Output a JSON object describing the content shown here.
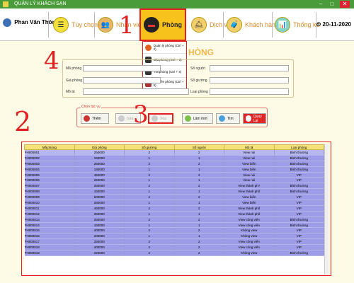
{
  "window": {
    "title": "QUẢN LÝ KHÁCH SẠN",
    "min": "–",
    "max": "□",
    "close": "✕"
  },
  "toolbar": {
    "user": "Phan Văn Thông",
    "items": [
      {
        "label": "Tùy chọn",
        "icon": "list-icon"
      },
      {
        "label": "Nhân viên",
        "icon": "staff-icon"
      },
      {
        "label": "Phòng",
        "icon": "room-icon"
      },
      {
        "label": "Dịch vụ",
        "icon": "service-icon"
      },
      {
        "label": "Khách hàng",
        "icon": "customer-icon"
      },
      {
        "label": "Thống kê",
        "icon": "stats-icon"
      }
    ],
    "date": "20-11-2020"
  },
  "room_menu": [
    "Quản lý phòng (Ctrl + 2)",
    "Đặt phòng (Ctrl + 3)",
    "Trả phòng (Ctrl + 4)",
    "Chuyển phòng (Ctrl + 5)"
  ],
  "annotations": {
    "a1": "1",
    "a2": "2",
    "a3": "3",
    "a4": "4"
  },
  "ghost_title": "HÒNG",
  "form": {
    "ma_phong": "Mã phòng",
    "gia_phong": "Giá phòng",
    "mo_ta": "Mô tả",
    "so_nguoi": "Số người",
    "so_giuong": "Số giường",
    "loai_phong": "Loại phòng"
  },
  "actions": {
    "group": "Chọn tác vụ",
    "them": "Thêm",
    "sua": "Sửa",
    "xoa": "Xóa",
    "lam_moi": "Làm mới",
    "tim": "Tìm",
    "quay_lai": "Quay Lại"
  },
  "table": {
    "columns": [
      "Mã phòng",
      "Giá phòng",
      "Số giường",
      "Số người",
      "Mô tả",
      "Loại phòng"
    ],
    "rows": [
      [
        "PH000001",
        "250000",
        "2",
        "2",
        "View núi",
        "Bình thường"
      ],
      [
        "PH000002",
        "150000",
        "1",
        "1",
        "View núi",
        "Bình thường"
      ],
      [
        "PH000003",
        "250000",
        "2",
        "2",
        "View biển",
        "Bình thường"
      ],
      [
        "PH000004",
        "180000",
        "1",
        "1",
        "View biển",
        "Bình thường"
      ],
      [
        "PH000005",
        "450000",
        "2",
        "2",
        "View núi",
        "VIP"
      ],
      [
        "PH000006",
        "250000",
        "1",
        "1",
        "View núi",
        "VIP"
      ],
      [
        "PH000007",
        "250000",
        "2",
        "2",
        "View thành ph?",
        "Bình thường"
      ],
      [
        "PH000008",
        "150000",
        "1",
        "1",
        "View thành phố",
        "Bình thường"
      ],
      [
        "PH000009",
        "500000",
        "2",
        "2",
        "View biển",
        "VIP"
      ],
      [
        "PH000010",
        "280000",
        "1",
        "1",
        "View biển",
        "VIP"
      ],
      [
        "PH000011",
        "450000",
        "2",
        "2",
        "View thành phố",
        "VIP"
      ],
      [
        "PH000012",
        "250000",
        "1",
        "1",
        "View thành phố",
        "VIP"
      ],
      [
        "PH000013",
        "250000",
        "2",
        "2",
        "View công viên",
        "Bình thường"
      ],
      [
        "PH000014",
        "150000",
        "1",
        "1",
        "View công viên",
        "Bình thường"
      ],
      [
        "PH000015",
        "400000",
        "2",
        "2",
        "Không view",
        "VIP"
      ],
      [
        "PH000016",
        "200000",
        "1",
        "1",
        "Không view",
        "VIP"
      ],
      [
        "PH000017",
        "250000",
        "2",
        "2",
        "View công viên",
        "VIP"
      ],
      [
        "PH000018",
        "400000",
        "2",
        "2",
        "View công viên",
        "VIP"
      ],
      [
        "PH000019",
        "220000",
        "2",
        "2",
        "Không view",
        "Bình thường"
      ]
    ]
  }
}
